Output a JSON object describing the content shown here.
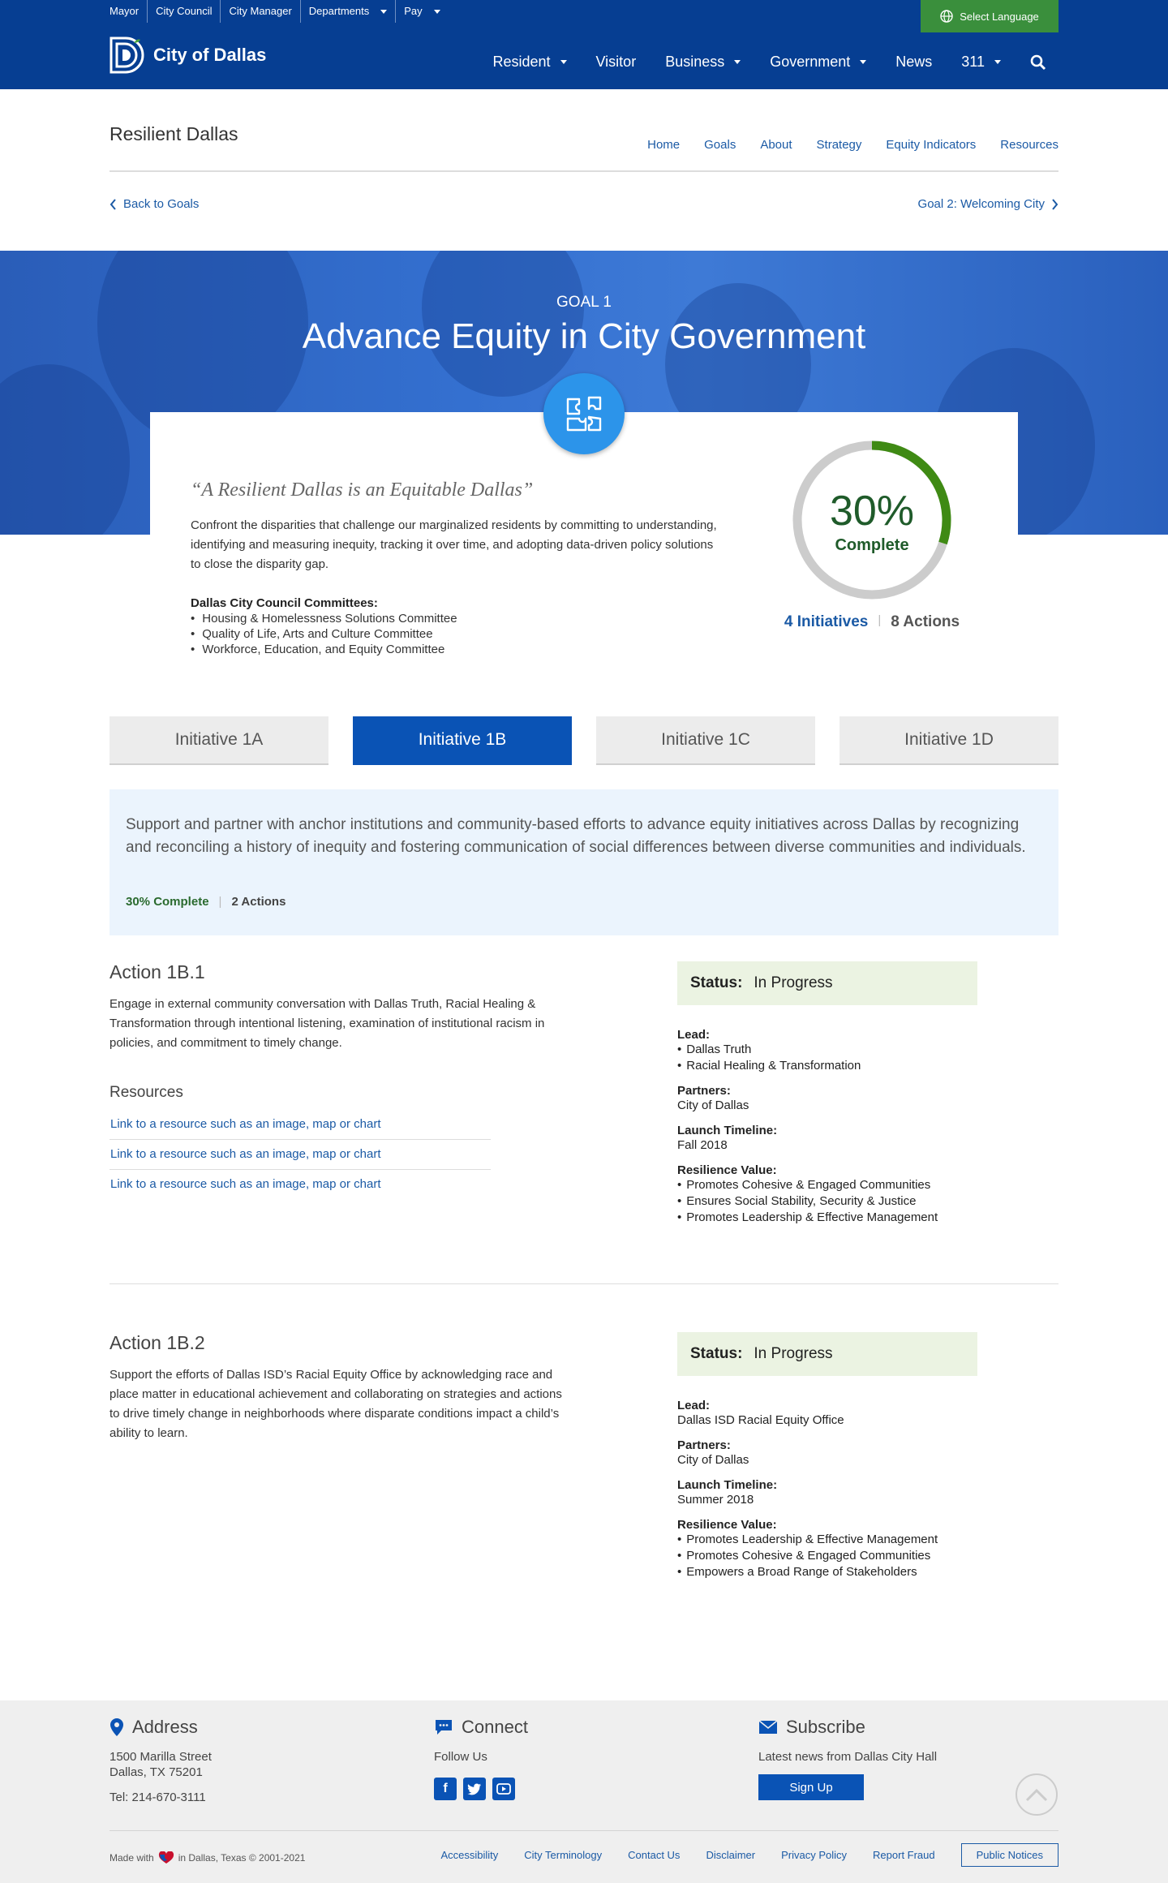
{
  "utility_nav": [
    {
      "label": "Mayor",
      "dropdown": false
    },
    {
      "label": "City Council",
      "dropdown": false
    },
    {
      "label": "City Manager",
      "dropdown": false
    },
    {
      "label": "Departments",
      "dropdown": true
    },
    {
      "label": "Pay",
      "dropdown": true
    }
  ],
  "language_button": "Select Language",
  "brand": "City of Dallas",
  "main_nav": [
    {
      "label": "Resident",
      "dropdown": true
    },
    {
      "label": "Visitor",
      "dropdown": false
    },
    {
      "label": "Business",
      "dropdown": true
    },
    {
      "label": "Government",
      "dropdown": true
    },
    {
      "label": "News",
      "dropdown": false
    },
    {
      "label": "311",
      "dropdown": true
    }
  ],
  "site_title": "Resilient Dallas",
  "sub_nav": [
    "Home",
    "Goals",
    "About",
    "Strategy",
    "Equity Indicators",
    "Resources"
  ],
  "back_link": "Back to Goals",
  "next_link": "Goal 2: Welcoming City",
  "hero": {
    "goal_label": "GOAL 1",
    "goal_title": "Advance Equity in City Government"
  },
  "card": {
    "quote": "“A Resilient Dallas is an Equitable Dallas”",
    "description": "Confront the disparities that challenge our marginalized residents by committing to understanding, identifying and measuring inequity, tracking it over time, and adopting data-driven policy solutions to close the disparity gap.",
    "committees_heading": "Dallas City Council Committees:",
    "committees": [
      "Housing & Homelessness Solutions Committee",
      "Quality of Life, Arts and Culture Committee",
      "Workforce, Education, and Equity Committee"
    ],
    "progress_percent": 30,
    "progress_text": "30%",
    "progress_label": "Complete",
    "initiatives": "4 Initiatives",
    "actions": "8 Actions",
    "colors": {
      "progress": "#3f8a14",
      "track": "#cccccc"
    }
  },
  "tabs": [
    {
      "label": "Initiative 1A",
      "active": false
    },
    {
      "label": "Initiative 1B",
      "active": true
    },
    {
      "label": "Initiative 1C",
      "active": false
    },
    {
      "label": "Initiative 1D",
      "active": false
    }
  ],
  "initiative": {
    "text": "Support and partner with anchor institutions and community-based efforts to advance equity initiatives across Dallas by recognizing and reconciling a history of inequity and fostering communication of social differences between diverse communities and individuals.",
    "complete": "30% Complete",
    "actions": "2 Actions"
  },
  "actions": [
    {
      "title": "Action 1B.1",
      "description": "Engage in external community conversation with Dallas Truth, Racial Healing & Transformation through intentional listening, examination of institutional racism in policies, and commitment to timely change.",
      "resources_heading": "Resources",
      "resources": [
        "Link to a resource such as an image, map or chart",
        "Link to a resource such as an image, map or chart",
        "Link to a resource such as an image, map or chart"
      ],
      "status_label": "Status:",
      "status": "In Progress",
      "lead_label": "Lead:",
      "lead": [
        "Dallas Truth",
        "Racial Healing & Transformation"
      ],
      "partners_label": "Partners:",
      "partners": "City of Dallas",
      "timeline_label": "Launch Timeline:",
      "timeline": "Fall 2018",
      "value_label": "Resilience Value:",
      "values": [
        "Promotes Cohesive & Engaged Communities",
        "Ensures Social Stability, Security & Justice",
        "Promotes Leadership & Effective Management"
      ]
    },
    {
      "title": "Action 1B.2",
      "description": "Support the efforts of Dallas ISD’s Racial Equity Office by acknowledging race and place matter in educational achievement and collaborating on strategies and actions to drive timely change in neighborhoods where disparate conditions impact a child’s ability to learn.",
      "status_label": "Status:",
      "status": "In Progress",
      "lead_label": "Lead:",
      "lead": "Dallas ISD Racial Equity Office",
      "partners_label": "Partners:",
      "partners": "City of Dallas",
      "timeline_label": "Launch Timeline:",
      "timeline": "Summer 2018",
      "value_label": "Resilience Value:",
      "values": [
        "Promotes Leadership & Effective Management",
        "Promotes Cohesive & Engaged Communities",
        "Empowers a Broad Range of Stakeholders"
      ]
    }
  ],
  "footer": {
    "address_heading": "Address",
    "address_line1": "1500 Marilla Street",
    "address_line2": "Dallas, TX 75201",
    "phone": "Tel: 214-670-3111",
    "connect_heading": "Connect",
    "follow": "Follow Us",
    "social_icons": [
      "facebook-icon",
      "twitter-icon",
      "youtube-icon"
    ],
    "subscribe_heading": "Subscribe",
    "subscribe_text": "Latest news from Dallas City Hall",
    "signup": "Sign Up",
    "made_with_prefix": "Made with",
    "made_with_suffix": "in Dallas, Texas © 2001-2021",
    "links": [
      "Accessibility",
      "City Terminology",
      "Contact Us",
      "Disclaimer",
      "Privacy Policy",
      "Report Fraud"
    ],
    "public_notices": "Public Notices"
  }
}
